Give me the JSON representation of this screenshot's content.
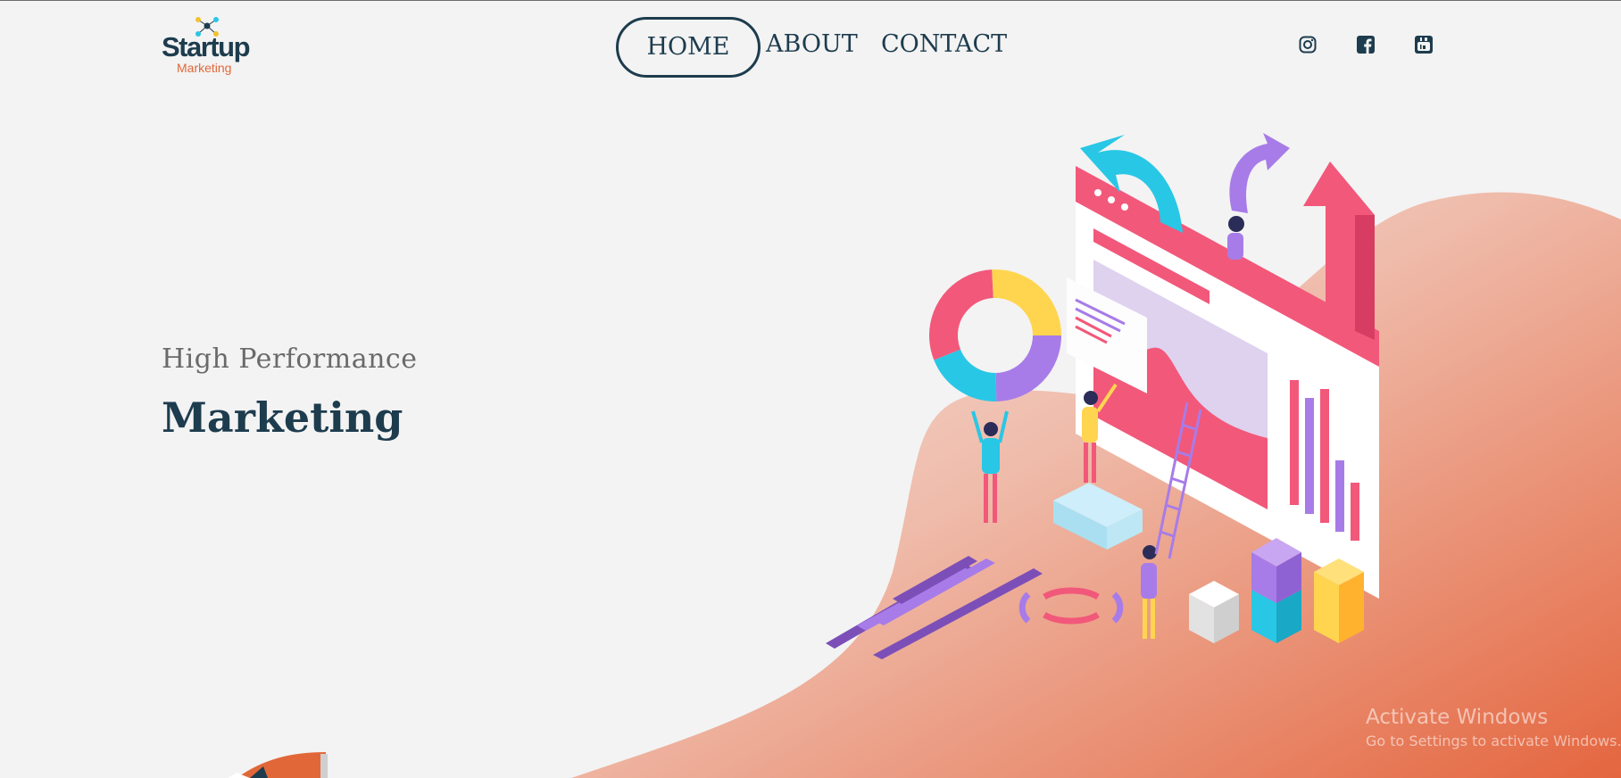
{
  "brand": {
    "name": "Startup",
    "tagline": "Marketing"
  },
  "nav": {
    "home": "HOME",
    "about": "ABOUT",
    "contact": "CONTACT"
  },
  "social": [
    "instagram-icon",
    "facebook-icon",
    "youtube-icon"
  ],
  "hero": {
    "subtitle": "High Performance",
    "title": "Marketing"
  },
  "watermark": {
    "line1": "Activate Windows",
    "line2": "Go to Settings to activate Windows."
  },
  "colors": {
    "text_dark": "#1d3c4e",
    "accent_orange": "#e26738",
    "pink": "#f2587a",
    "purple": "#a77ce8",
    "cyan": "#28c7e6",
    "yellow": "#ffd54f"
  }
}
